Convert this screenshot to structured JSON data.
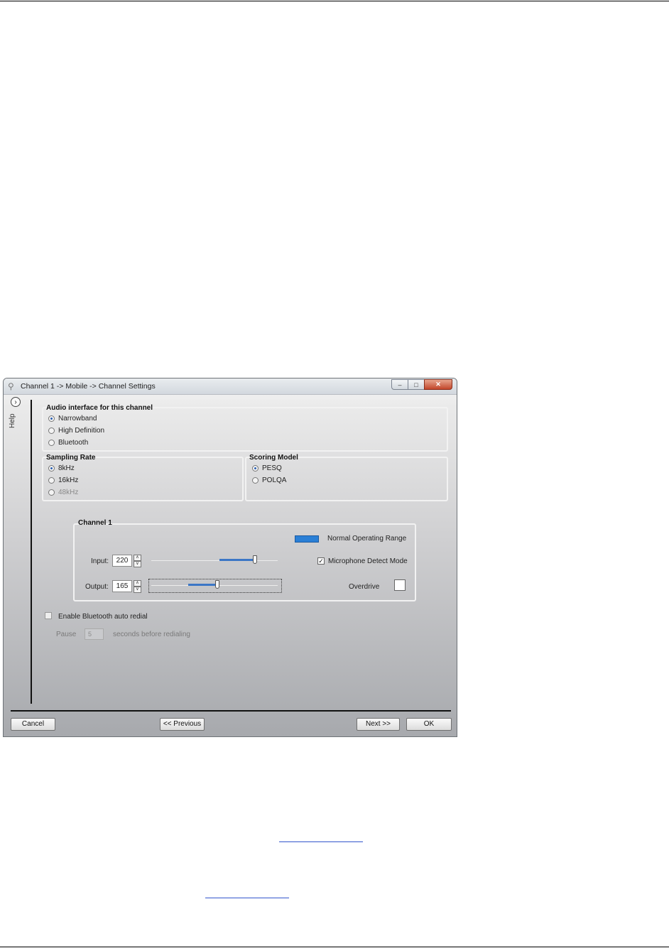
{
  "window": {
    "title": "Channel 1 -> Mobile -> Channel Settings",
    "controls": {
      "minimize": "–",
      "maximize": "□",
      "close": "✕"
    }
  },
  "help": {
    "label": "Help",
    "toggle": "›"
  },
  "audio_interface": {
    "title": "Audio interface for this channel",
    "options": [
      {
        "label": "Narrowband",
        "selected": true
      },
      {
        "label": "High Definition",
        "selected": false
      },
      {
        "label": "Bluetooth",
        "selected": false
      }
    ]
  },
  "sampling_rate": {
    "title": "Sampling Rate",
    "options": [
      {
        "label": "8kHz",
        "selected": true
      },
      {
        "label": "16kHz",
        "selected": false
      },
      {
        "label": "48kHz",
        "selected": false,
        "disabled": true
      }
    ]
  },
  "scoring_model": {
    "title": "Scoring Model",
    "options": [
      {
        "label": "PESQ",
        "selected": true
      },
      {
        "label": "POLQA",
        "selected": false
      }
    ]
  },
  "channel": {
    "title": "Channel 1",
    "legend": "Normal Operating Range",
    "legend_color": "#2a7fd6",
    "input": {
      "label": "Input:",
      "value": "220",
      "level": 0.82
    },
    "output": {
      "label": "Output:",
      "value": "165",
      "level": 0.52
    },
    "mic_detect": {
      "label": "Microphone Detect Mode",
      "checked": true,
      "mark": "✓"
    },
    "overdrive": {
      "label": "Overdrive",
      "checked": false
    }
  },
  "bluetooth": {
    "auto_redial_label": "Enable Bluetooth auto redial",
    "pause_label": "Pause",
    "pause_value": "5",
    "suffix": "seconds before redialing"
  },
  "buttons": {
    "cancel": "Cancel",
    "previous": "<< Previous",
    "next": "Next >>",
    "ok": "OK"
  }
}
